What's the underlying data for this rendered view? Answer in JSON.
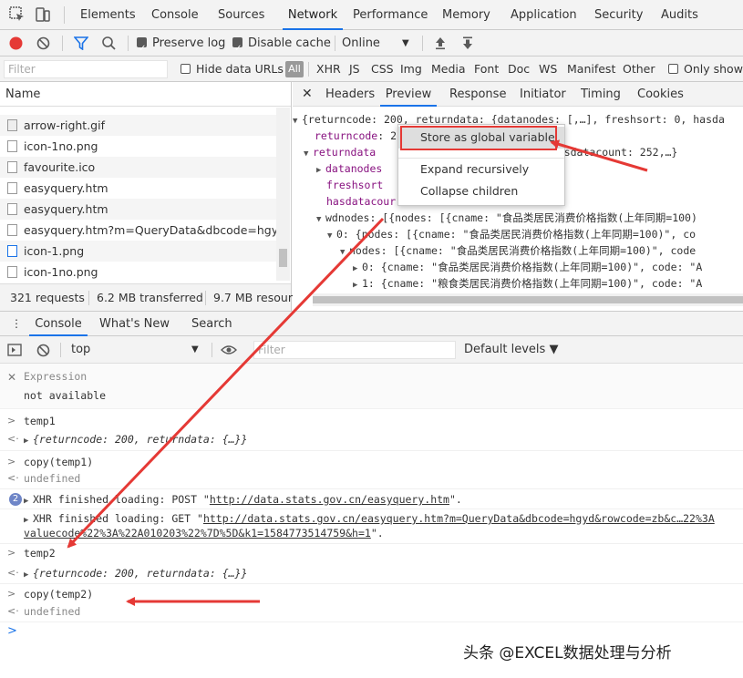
{
  "main_tabs": [
    "Elements",
    "Console",
    "Sources",
    "Network",
    "Performance",
    "Memory",
    "Application",
    "Security",
    "Audits"
  ],
  "active_tab": "Network",
  "network_toolbar": {
    "preserve_log": "Preserve log",
    "disable_cache": "Disable cache",
    "throttle": "Online"
  },
  "filter_bar": {
    "placeholder": "Filter",
    "hide_data_urls": "Hide data URLs",
    "all": "All",
    "types": [
      "XHR",
      "JS",
      "CSS",
      "Img",
      "Media",
      "Font",
      "Doc",
      "WS",
      "Manifest",
      "Other"
    ],
    "only_show": "Only show"
  },
  "requests": {
    "header": "Name",
    "rows": [
      "arrow-right.gif",
      "icon-1no.png",
      "favourite.ico",
      "easyquery.htm",
      "easyquery.htm",
      "easyquery.htm?m=QueryData&dbcode=hgyd&",
      "icon-1.png",
      "icon-1no.png"
    ],
    "status": {
      "requests": "321 requests",
      "transferred": "6.2 MB transferred",
      "resources": "9.7 MB resour"
    }
  },
  "preview_tabs": [
    "Headers",
    "Preview",
    "Response",
    "Initiator",
    "Timing",
    "Cookies"
  ],
  "active_preview_tab": "Preview",
  "preview_lines": {
    "l1a": "{returncode: 200, returndata: {datanodes: [,…], freshsort: 0, hasda",
    "l2k": "returncode",
    "l2v": ": 2",
    "l3k": "returndata",
    "l3v": ": 0, hasdatacount: 252,…}",
    "l4k": "datanodes",
    "l5k": "freshsort",
    "l6k": "hasdatacour",
    "l7": "wdnodes: [{nodes: [{cname: \"食品类居民消费价格指数(上年同期=100)",
    "l8": "0: {nodes: [{cname: \"食品类居民消费价格指数(上年同期=100)\", co",
    "l9": "nodes: [{cname: \"食品类居民消费价格指数(上年同期=100)\", code",
    "l10": "0: {cname: \"食品类居民消费价格指数(上年同期=100)\", code: \"A",
    "l11": "1: {cname: \"粮食类居民消费价格指数(上年同期=100)\", code: \"A"
  },
  "context_menu": {
    "store_global": "Store as global variable",
    "expand": "Expand recursively",
    "collapse": "Collapse children"
  },
  "drawer_tabs": [
    "Console",
    "What's New",
    "Search"
  ],
  "active_drawer_tab": "Console",
  "console_toolbar": {
    "context": "top",
    "filter_placeholder": "Filter",
    "levels": "Default levels ▼"
  },
  "console": {
    "expression_label": "Expression",
    "expression_value": "not available",
    "cmd1": "temp1",
    "out1": "{returncode: 200, returndata: {…}}",
    "cmd2": "copy(temp1)",
    "out2": "undefined",
    "xhr_count": "2",
    "xhr1_prefix": "XHR finished loading: POST \"",
    "xhr1_url": "http://data.stats.gov.cn/easyquery.htm",
    "xhr1_suffix": "\".",
    "xhr2_prefix": "XHR finished loading: GET \"",
    "xhr2_url": "http://data.stats.gov.cn/easyquery.htm?m=QueryData&dbcode=hgyd&rowcode=zb&c…22%3A",
    "xhr2_url2": "valuecode%22%3A%22A010203%22%7D%5D&k1=1584773514759&h=1",
    "xhr2_suffix": "\".",
    "cmd3": "temp2",
    "out3": "{returncode: 200, returndata: {…}}",
    "cmd4": "copy(temp2)",
    "out4": "undefined"
  },
  "watermark": "头条 @EXCEL数据处理与分析",
  "colors": {
    "accent": "#1a73e8",
    "record": "#e53935",
    "arrow": "#e53935"
  }
}
